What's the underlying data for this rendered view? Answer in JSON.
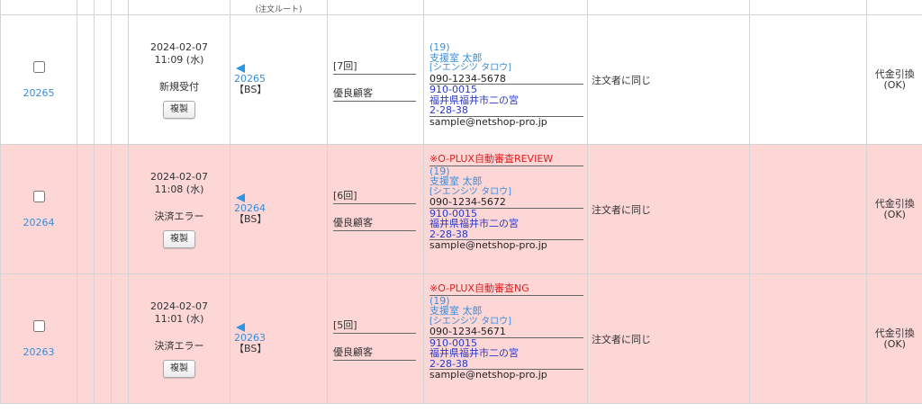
{
  "header": {
    "partial_label": "(注文ルート)"
  },
  "common": {
    "copy_button": "複製",
    "same_as_orderer": "注文者に同じ",
    "payment_method": "代金引換",
    "payment_status": "(OK)",
    "customer_rank": "優良顧客",
    "bs_tag": "【BS】"
  },
  "orders": [
    {
      "id": "20265",
      "date": "2024-02-07",
      "time": "11:09 (水)",
      "status": "新規受付",
      "ref": "20265",
      "count": "[7回]",
      "alert": "",
      "kana_num": "(19)",
      "name": "支援室 太郎",
      "kana": "[シエンシツ タロウ]",
      "phone": "090-1234-5678",
      "zip": "910-0015",
      "address1": "福井県福井市二の宮",
      "address2": "2-28-38",
      "email": "sample@netshop-pro.jp",
      "row_color": "#ffffff"
    },
    {
      "id": "20264",
      "date": "2024-02-07",
      "time": "11:08 (水)",
      "status": "決済エラー",
      "ref": "20264",
      "count": "[6回]",
      "alert": "※O-PLUX自動審査REVIEW",
      "kana_num": "(19)",
      "name": "支援室 太郎",
      "kana": "[シエンシツ タロウ]",
      "phone": "090-1234-5672",
      "zip": "910-0015",
      "address1": "福井県福井市二の宮",
      "address2": "2-28-38",
      "email": "sample@netshop-pro.jp",
      "row_color": "#fdd6d6"
    },
    {
      "id": "20263",
      "date": "2024-02-07",
      "time": "11:01 (水)",
      "status": "決済エラー",
      "ref": "20263",
      "count": "[5回]",
      "alert": "※O-PLUX自動審査NG",
      "kana_num": "(19)",
      "name": "支援室 太郎",
      "kana": "[シエンシツ タロウ]",
      "phone": "090-1234-5671",
      "zip": "910-0015",
      "address1": "福井県福井市二の宮",
      "address2": "2-28-38",
      "email": "sample@netshop-pro.jp",
      "row_color": "#fdd6d6"
    }
  ]
}
